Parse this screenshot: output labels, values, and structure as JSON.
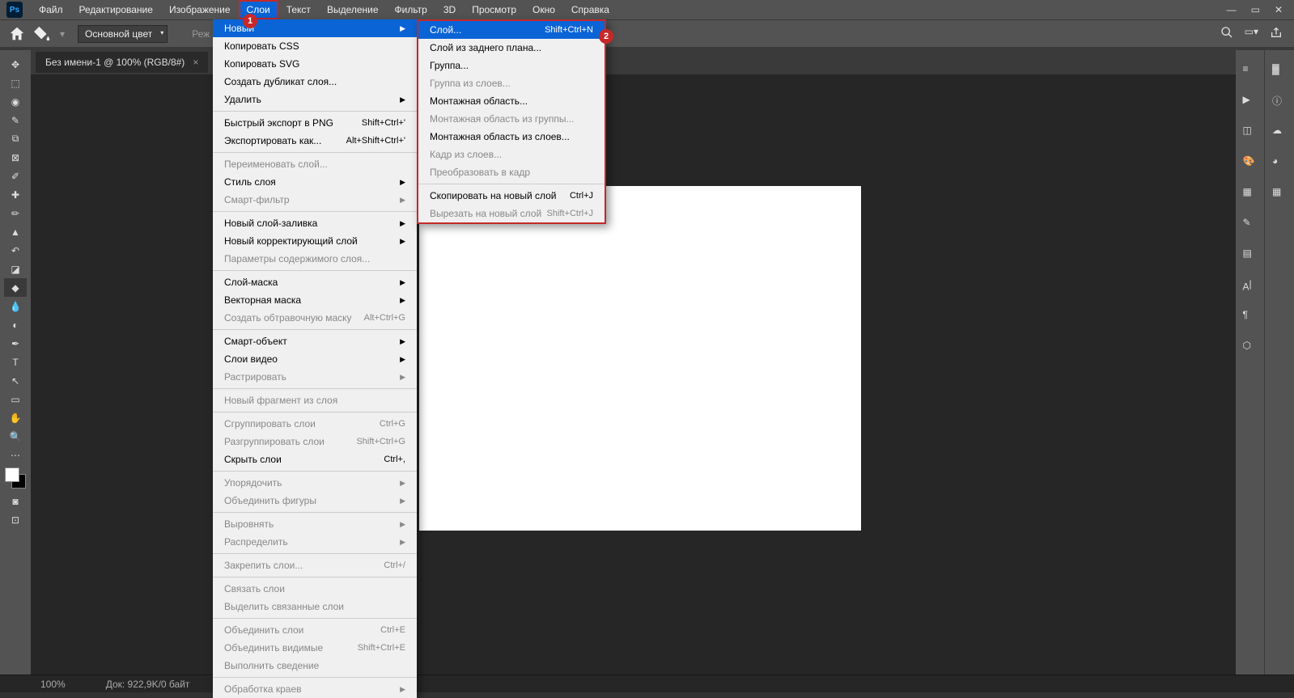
{
  "app": {
    "logo": "Ps",
    "menu": [
      "Файл",
      "Редактирование",
      "Изображение",
      "Слои",
      "Текст",
      "Выделение",
      "Фильтр",
      "3D",
      "Просмотр",
      "Окно",
      "Справка"
    ],
    "active_menu_index": 3
  },
  "optbar": {
    "fill_mode": "Основной цвет",
    "mode_lbl_partial": "Реж"
  },
  "tab": {
    "title": "Без имени-1 @ 100% (RGB/8#)",
    "close": "×"
  },
  "dd1": {
    "items": [
      {
        "label": "Новый",
        "arrow": true,
        "hl": true
      },
      {
        "label": "Копировать CSS"
      },
      {
        "label": "Копировать SVG"
      },
      {
        "label": "Создать дубликат слоя..."
      },
      {
        "label": "Удалить",
        "arrow": true
      },
      {
        "sep": true
      },
      {
        "label": "Быстрый экспорт в PNG",
        "sc": "Shift+Ctrl+'"
      },
      {
        "label": "Экспортировать как...",
        "sc": "Alt+Shift+Ctrl+'"
      },
      {
        "sep": true
      },
      {
        "label": "Переименовать слой...",
        "disabled": true
      },
      {
        "label": "Стиль слоя",
        "arrow": true
      },
      {
        "label": "Смарт-фильтр",
        "arrow": true,
        "disabled": true
      },
      {
        "sep": true
      },
      {
        "label": "Новый слой-заливка",
        "arrow": true
      },
      {
        "label": "Новый корректирующий слой",
        "arrow": true
      },
      {
        "label": "Параметры содержимого слоя...",
        "disabled": true
      },
      {
        "sep": true
      },
      {
        "label": "Слой-маска",
        "arrow": true
      },
      {
        "label": "Векторная маска",
        "arrow": true
      },
      {
        "label": "Создать обтравочную маску",
        "sc": "Alt+Ctrl+G",
        "disabled": true
      },
      {
        "sep": true
      },
      {
        "label": "Смарт-объект",
        "arrow": true
      },
      {
        "label": "Слои видео",
        "arrow": true
      },
      {
        "label": "Растрировать",
        "arrow": true,
        "disabled": true
      },
      {
        "sep": true
      },
      {
        "label": "Новый фрагмент из слоя",
        "disabled": true
      },
      {
        "sep": true
      },
      {
        "label": "Сгруппировать слои",
        "sc": "Ctrl+G",
        "disabled": true
      },
      {
        "label": "Разгруппировать слои",
        "sc": "Shift+Ctrl+G",
        "disabled": true
      },
      {
        "label": "Скрыть слои",
        "sc": "Ctrl+,"
      },
      {
        "sep": true
      },
      {
        "label": "Упорядочить",
        "arrow": true,
        "disabled": true
      },
      {
        "label": "Объединить фигуры",
        "arrow": true,
        "disabled": true
      },
      {
        "sep": true
      },
      {
        "label": "Выровнять",
        "arrow": true,
        "disabled": true
      },
      {
        "label": "Распределить",
        "arrow": true,
        "disabled": true
      },
      {
        "sep": true
      },
      {
        "label": "Закрепить слои...",
        "sc": "Ctrl+/",
        "disabled": true
      },
      {
        "sep": true
      },
      {
        "label": "Связать слои",
        "disabled": true
      },
      {
        "label": "Выделить связанные слои",
        "disabled": true
      },
      {
        "sep": true
      },
      {
        "label": "Объединить слои",
        "sc": "Ctrl+E",
        "disabled": true
      },
      {
        "label": "Объединить видимые",
        "sc": "Shift+Ctrl+E",
        "disabled": true
      },
      {
        "label": "Выполнить сведение",
        "disabled": true
      },
      {
        "sep": true
      },
      {
        "label": "Обработка краев",
        "arrow": true,
        "disabled": true
      }
    ]
  },
  "dd2": {
    "items": [
      {
        "label": "Слой...",
        "sc": "Shift+Ctrl+N",
        "hl": true
      },
      {
        "label": "Слой из заднего плана..."
      },
      {
        "label": "Группа..."
      },
      {
        "label": "Группа из слоев...",
        "disabled": true
      },
      {
        "label": "Монтажная область..."
      },
      {
        "label": "Монтажная область из группы...",
        "disabled": true
      },
      {
        "label": "Монтажная область из слоев..."
      },
      {
        "label": "Кадр из слоев...",
        "disabled": true
      },
      {
        "label": "Преобразовать в кадр",
        "disabled": true
      },
      {
        "sep": true
      },
      {
        "label": "Скопировать на новый слой",
        "sc": "Ctrl+J"
      },
      {
        "label": "Вырезать на новый слой",
        "sc": "Shift+Ctrl+J",
        "disabled": true
      }
    ]
  },
  "status": {
    "zoom": "100%",
    "info": "Док: 922,9K/0 байт"
  },
  "badges": {
    "one": "1",
    "two": "2"
  }
}
